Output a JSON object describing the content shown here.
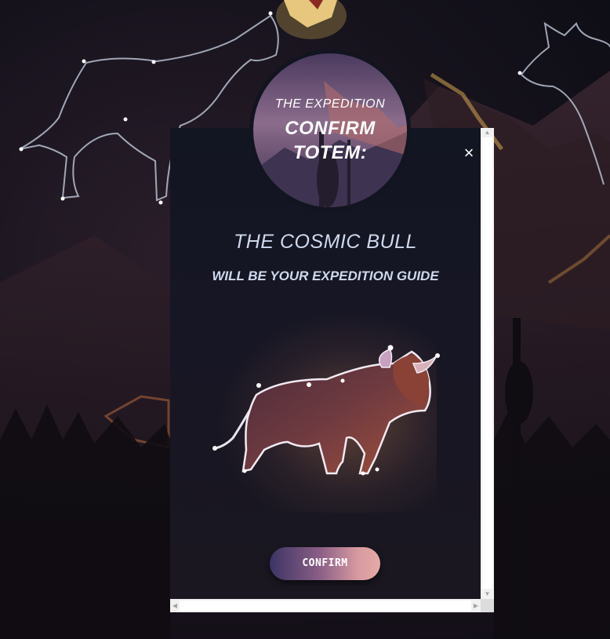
{
  "colors": {
    "modal_bg": "#121522",
    "heading_text": "#cfd9ee",
    "button_gradient_start": "#3c3464",
    "button_gradient_end": "#e5aaa6",
    "constellation_line": "#b7bfd0"
  },
  "icons": {
    "close": "close-icon",
    "crown": "crown-icon",
    "bull": "cosmic-bull-illustration",
    "constellations": "constellation-art"
  },
  "emblem": {
    "subtitle": "THE EXPEDITION",
    "title_line1": "CONFIRM",
    "title_line2": "TOTEM:"
  },
  "close_label": "×",
  "totem": {
    "name": "THE COSMIC BULL",
    "subtitle": "WILL BE YOUR EXPEDITION GUIDE"
  },
  "confirm_label": "CONFIRM"
}
